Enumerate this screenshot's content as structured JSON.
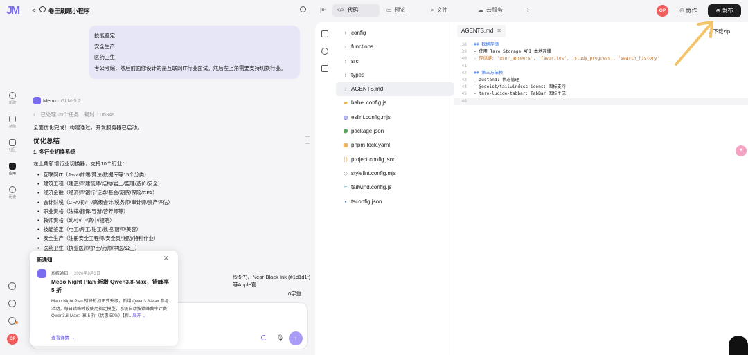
{
  "header": {
    "logo": "JM",
    "back_glyph": "<",
    "app_title": "卷王刷题小程序",
    "tabs": [
      {
        "icon": "</>",
        "label": "代码",
        "active": true
      },
      {
        "icon": "▭",
        "label": "预览",
        "active": false
      },
      {
        "icon": "⌕",
        "label": "文件",
        "active": false
      },
      {
        "icon": "☁",
        "label": "云服务",
        "active": false
      }
    ],
    "plus": "+",
    "avatar": "OP",
    "collab_label": "协作",
    "publish_label": "发布"
  },
  "rail": {
    "items": [
      {
        "label": "新建"
      },
      {
        "label": "技能"
      },
      {
        "label": "社区"
      },
      {
        "label": "应用",
        "active": true
      },
      {
        "label": "历史"
      }
    ],
    "avatar": "OP"
  },
  "chat": {
    "user_lines": [
      "技能鉴定",
      "安全生产",
      "医药卫生",
      "考公考编，然后前面你设计的是互联网IT行业面试。然后左上角需要支持切换行业。"
    ],
    "ai_name": "Meoo",
    "ai_model": "· GLM-5.2",
    "task_done": "已处理 20个任务",
    "task_time": "耗时 11m34s",
    "summary": "全面优化完成！构建通过，开发服务器已启动。",
    "heading": "优化总结",
    "subheading": "1. 多行业切换系统",
    "intro": "左上角新增行业切换器，支持10个行业：",
    "industries": [
      "互联网IT（Java/前端/算法/数据库等15个分类）",
      "建筑工程（建造师/建筑师/结构/岩土/监理/造价/安全）",
      "经济金融（经济师/银行/证券/基金/期货/保险/CFA）",
      "会计财税（CPA/初/中/高级会计/税务师/审计师/资产评估）",
      "职业资格（法律/翻译/导游/营养师等）",
      "教师资格（幼/小/中/高中/招聘）",
      "技能鉴定（电工/焊工/钳工/数控/厨师/美容）",
      "安全生产（注册安全工程师/安全员/消防/特种作业）",
      "医药卫生（执业医师/护士/药师/中医/公卫）"
    ],
    "partial_text_1": "f5f5f7)、Near-Black Ink (#1d1d1f) 等Apple官",
    "partial_text_2": "0字重"
  },
  "notification": {
    "title": "新通知",
    "source": "系统通知",
    "date": "2026年8月3日",
    "headline": "Meoo Night Plan 新增 Qwen3.8-Max，错峰享 5 折",
    "body": "Meoo Night Plan 错峰折扣正式升级，新增 Qwen3.8-Max 参与活动。每日错峰时段使用指定模型，系统自动按错峰费率计费：",
    "body_tail": "Qwen3.8-Max：享 5 折（优惠 50%）【新...",
    "expand": "展开 ⌄",
    "link": "查看详情 →"
  },
  "explorer": {
    "files": [
      {
        "name": "config",
        "type": "folder"
      },
      {
        "name": "functions",
        "type": "folder"
      },
      {
        "name": "src",
        "type": "folder"
      },
      {
        "name": "types",
        "type": "folder"
      },
      {
        "name": "AGENTS.md",
        "type": "md",
        "active": true
      },
      {
        "name": "babel.config.js",
        "type": "js"
      },
      {
        "name": "eslint.config.mjs",
        "type": "mjs"
      },
      {
        "name": "package.json",
        "type": "json"
      },
      {
        "name": "pnpm-lock.yaml",
        "type": "yaml"
      },
      {
        "name": "project.config.json",
        "type": "json"
      },
      {
        "name": "stylelint.config.mjs",
        "type": "mjs"
      },
      {
        "name": "tailwind.config.js",
        "type": "js"
      },
      {
        "name": "tsconfig.json",
        "type": "ts"
      }
    ]
  },
  "editor": {
    "tab": "AGENTS.md",
    "download": "下载zip",
    "lines": [
      {
        "n": "38",
        "code": "## 数据存储"
      },
      {
        "n": "39",
        "code": "- 使用 Taro Storage API 本地存储"
      },
      {
        "n": "40",
        "code": "- 存储键: 'user_answers', 'favorites', 'study_progress', 'search_history'"
      },
      {
        "n": "41",
        "code": ""
      },
      {
        "n": "42",
        "code": "## 第三方依赖"
      },
      {
        "n": "43",
        "code": "- zustand: 状态管理"
      },
      {
        "n": "44",
        "code": "- @egoist/tailwindcss-icons: 图标支持"
      },
      {
        "n": "45",
        "code": "- taro-lucide-tabbar: TabBar 图标生成"
      },
      {
        "n": "46",
        "code": ""
      }
    ]
  },
  "colors": {
    "accent": "#7a6cf0",
    "bubble": "#e6e6f7",
    "publish": "#1d1d1f",
    "avatar": "#ef5d5d",
    "arrow": "#f4c46a"
  }
}
